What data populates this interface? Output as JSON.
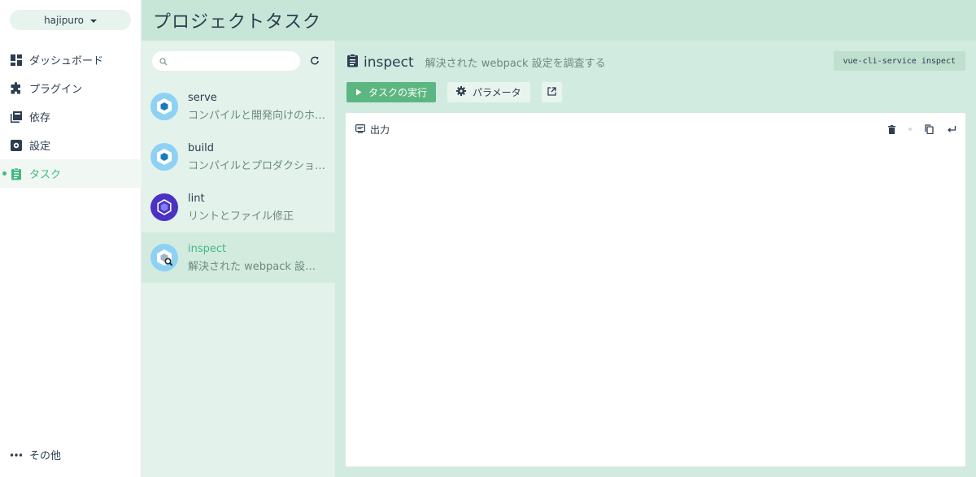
{
  "project": {
    "name": "hajipuro"
  },
  "nav": {
    "items": [
      {
        "label": "ダッシュボード",
        "icon": "dashboard-icon"
      },
      {
        "label": "プラグイン",
        "icon": "puzzle-icon"
      },
      {
        "label": "依存",
        "icon": "library-icon"
      },
      {
        "label": "設定",
        "icon": "gear-icon"
      },
      {
        "label": "タスク",
        "icon": "clipboard-icon",
        "active": true
      }
    ],
    "more_label": "その他"
  },
  "header": {
    "title": "プロジェクトタスク"
  },
  "search": {
    "placeholder": ""
  },
  "tasks": [
    {
      "name": "serve",
      "description": "コンパイルと開発向けのホ…",
      "icon": "webpack-icon"
    },
    {
      "name": "build",
      "description": "コンパイルとプロダクショ…",
      "icon": "webpack-icon"
    },
    {
      "name": "lint",
      "description": "リントとファイル修正",
      "icon": "eslint-icon"
    },
    {
      "name": "inspect",
      "description": "解決された webpack 設定…",
      "icon": "webpack-inspect-icon",
      "active": true
    }
  ],
  "main": {
    "task_name": "inspect",
    "task_description": "解決された webpack 設定を調査する",
    "command": "vue-cli-service inspect",
    "run_label": "タスクの実行",
    "params_label": "パラメータ",
    "output_label": "出力"
  },
  "colors": {
    "accent": "#42b983",
    "header_bg": "#c8e6d7",
    "tasks_bg": "#e3f2ea",
    "main_bg": "#d1ebe0"
  }
}
